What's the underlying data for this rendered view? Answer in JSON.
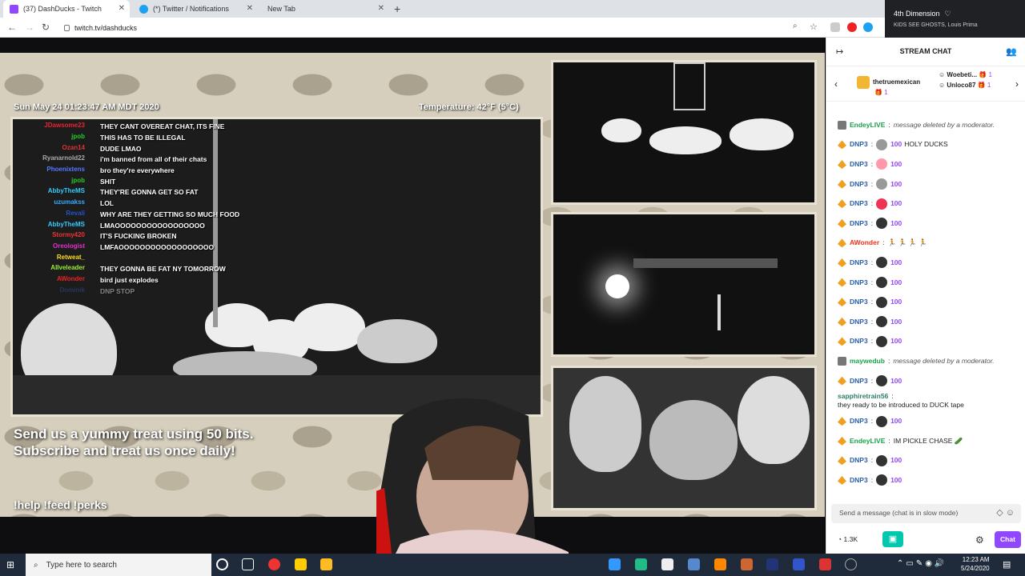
{
  "browser": {
    "tabs": [
      {
        "title": "(37) DashDucks - Twitch",
        "icon": "twitch-icon",
        "color": "#9147ff"
      },
      {
        "title": "(*) Twitter / Notifications",
        "icon": "twitter-icon",
        "color": "#1da1f2"
      },
      {
        "title": "New Tab",
        "icon": "",
        "color": ""
      }
    ],
    "new_tab": "+",
    "url": "twitch.tv/dashducks"
  },
  "media": {
    "track": "4th Dimension",
    "artist": "KIDS SEE GHOSTS, Louis Prima"
  },
  "stream": {
    "datetime": "Sun May 24 01:23:47 AM MDT 2020",
    "temperature": "Temperature: 42°F (5°C)",
    "treat_line1": "Send us a yummy treat using 50 bits.",
    "treat_line2": "Subscribe and treat us once daily!",
    "commands": "!help !feed !perks",
    "overlay_chat": [
      {
        "name": "JDawsome23",
        "color": "#e23",
        "msg": "THEY CANT OVEREAT CHAT, ITS FINE"
      },
      {
        "name": "jpob",
        "color": "#2c2",
        "msg": "THIS HAS TO BE ILLEGAL"
      },
      {
        "name": "Ozan14",
        "color": "#d33",
        "msg": "DUDE LMAO"
      },
      {
        "name": "Ryanarnold22",
        "color": "#aaa",
        "msg": "i'm banned from all of their chats"
      },
      {
        "name": "Phoenixtens",
        "color": "#57f",
        "msg": "bro they're everywhere"
      },
      {
        "name": "jpob",
        "color": "#2c2",
        "msg": "SHIT"
      },
      {
        "name": "AbbyTheMS",
        "color": "#3cf",
        "msg": "THEY'RE GONNA GET SO FAT"
      },
      {
        "name": "uzumakss",
        "color": "#3af",
        "msg": "LOL"
      },
      {
        "name": "Revali",
        "color": "#25c",
        "msg": "WHY ARE THEY GETTING SO MUCH FOOD"
      },
      {
        "name": "AbbyTheMS",
        "color": "#3cf",
        "msg": "LMAOOOOOOOOOOOOOOOOO"
      },
      {
        "name": "Stormy420",
        "color": "#e33",
        "msg": "IT'S FUCKING BROKEN"
      },
      {
        "name": "Oreologist",
        "color": "#d3c",
        "msg": "LMFAOOOOOOOOOOOOOOOOOO"
      },
      {
        "name": "Retweat_",
        "color": "#fd2",
        "msg": ""
      },
      {
        "name": "AIIveleader",
        "color": "#9e3",
        "msg": "THEY GONNA BE FAT NY TOMORROW"
      },
      {
        "name": "AWonder",
        "color": "#e22",
        "msg": "bird just explodes"
      },
      {
        "name": "Dominik",
        "color": "#35a",
        "msg": "DNP STOP"
      }
    ]
  },
  "chat": {
    "title": "STREAM CHAT",
    "gifts": [
      {
        "name": "thetruemexican",
        "count": "1"
      },
      {
        "name": "Woebeti...",
        "count": "1"
      },
      {
        "name": "Unloco87",
        "count": "1"
      }
    ],
    "messages": [
      {
        "user": "EndeyLIVE",
        "color": "#1aa34a",
        "sep": ":",
        "text": "message deleted by a moderator.",
        "deleted": true,
        "bits": "",
        "emote": ""
      },
      {
        "user": "DNP3",
        "color": "#2a5fa8",
        "sep": ":",
        "text": "HOLY DUCKS",
        "bits": "100",
        "emote": "#999"
      },
      {
        "user": "DNP3",
        "color": "#2a5fa8",
        "sep": ":",
        "text": "",
        "bits": "100",
        "emote": "#f9a"
      },
      {
        "user": "DNP3",
        "color": "#2a5fa8",
        "sep": ":",
        "text": "",
        "bits": "100",
        "emote": "#999"
      },
      {
        "user": "DNP3",
        "color": "#2a5fa8",
        "sep": ":",
        "text": "",
        "bits": "100",
        "emote": "#e35"
      },
      {
        "user": "DNP3",
        "color": "#2a5fa8",
        "sep": ":",
        "text": "",
        "bits": "100",
        "emote": "#333"
      },
      {
        "user": "AWonder",
        "color": "#e5341a",
        "sep": ":",
        "text": "🏃 🏃 🏃 🏃",
        "bits": "",
        "emote": ""
      },
      {
        "user": "DNP3",
        "color": "#2a5fa8",
        "sep": ":",
        "text": "",
        "bits": "100",
        "emote": "#333"
      },
      {
        "user": "DNP3",
        "color": "#2a5fa8",
        "sep": ":",
        "text": "",
        "bits": "100",
        "emote": "#333"
      },
      {
        "user": "DNP3",
        "color": "#2a5fa8",
        "sep": ":",
        "text": "",
        "bits": "100",
        "emote": "#333"
      },
      {
        "user": "DNP3",
        "color": "#2a5fa8",
        "sep": ":",
        "text": "",
        "bits": "100",
        "emote": "#333"
      },
      {
        "user": "DNP3",
        "color": "#2a5fa8",
        "sep": ":",
        "text": "",
        "bits": "100",
        "emote": "#333"
      },
      {
        "user": "maywedub",
        "color": "#1aa34a",
        "sep": ":",
        "text": "message deleted by a moderator.",
        "deleted": true,
        "bits": "",
        "emote": ""
      },
      {
        "user": "DNP3",
        "color": "#2a5fa8",
        "sep": ":",
        "text": "",
        "bits": "100",
        "emote": "#333"
      },
      {
        "user": "sapphiretrain56",
        "color": "#2e7d6b",
        "sep": ":",
        "text": "they ready to be introduced to DUCK tape",
        "bits": "",
        "emote": "",
        "plain": true
      },
      {
        "user": "DNP3",
        "color": "#2a5fa8",
        "sep": ":",
        "text": "",
        "bits": "100",
        "emote": "#333"
      },
      {
        "user": "EndeyLIVE",
        "color": "#1aa34a",
        "sep": ":",
        "text": "IM PICKLE CHASE 🥒",
        "bits": "",
        "emote": ""
      },
      {
        "user": "DNP3",
        "color": "#2a5fa8",
        "sep": ":",
        "text": "",
        "bits": "100",
        "emote": "#333"
      },
      {
        "user": "DNP3",
        "color": "#2a5fa8",
        "sep": ":",
        "text": "",
        "bits": "100",
        "emote": "#333"
      }
    ],
    "input_placeholder": "Send a message (chat is in slow mode)",
    "points": "1.3K",
    "chat_button": "Chat"
  },
  "taskbar": {
    "search": "Type here to search",
    "time": "12:23 AM",
    "date": "5/24/2020"
  }
}
